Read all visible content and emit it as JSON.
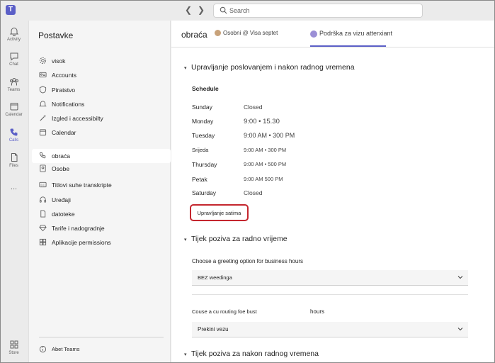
{
  "search": {
    "placeholder": "Search"
  },
  "rail": {
    "items": [
      {
        "label": "Activity",
        "icon": "bell-icon"
      },
      {
        "label": "Chat",
        "icon": "chat-icon"
      },
      {
        "label": "Teams",
        "icon": "teams-icon"
      },
      {
        "label": "Calendar",
        "icon": "calendar-icon"
      },
      {
        "label": "Calls",
        "icon": "phone-icon",
        "active": true
      },
      {
        "label": "Files",
        "icon": "file-icon"
      },
      {
        "label": "...",
        "icon": "more-icon"
      },
      {
        "label": "Store",
        "icon": "store-icon"
      }
    ]
  },
  "settings": {
    "title": "Postavke",
    "items": [
      {
        "label": "visok",
        "icon": "gear-icon"
      },
      {
        "label": "Accounts",
        "icon": "id-card-icon"
      },
      {
        "label": "Piratstvo",
        "icon": "shield-icon"
      },
      {
        "label": "Notifications",
        "icon": "bell-icon"
      },
      {
        "label": "Izgled i accessibilty",
        "icon": "wand-icon"
      },
      {
        "label": "Calendar",
        "icon": "calendar-icon"
      },
      {
        "label": "obraća",
        "icon": "phone-icon",
        "selected": true
      },
      {
        "label": "Osobe",
        "icon": "contact-card-icon"
      },
      {
        "label": "Titlovi suhe transkripte",
        "icon": "cc-icon"
      },
      {
        "label": "Uređaji",
        "icon": "headset-icon"
      },
      {
        "label": "datoteke",
        "icon": "file-icon"
      },
      {
        "label": "Tarife i nadogradnje",
        "icon": "diamond-icon"
      },
      {
        "label": "Aplikacije permissions",
        "icon": "apps-icon"
      }
    ],
    "footer": {
      "label": "Abet Teams",
      "icon": "info-icon"
    }
  },
  "main": {
    "title": "obraća",
    "tabs": [
      {
        "label": "Osobni @ Visa septet"
      },
      {
        "label": "Podrška za vizu atterxiant"
      }
    ],
    "business_hours": {
      "heading": "Upravljanje poslovanjem i nakon radnog vremena",
      "schedule_title": "Schedule",
      "days": [
        {
          "day": "Sunday",
          "time": "Closed"
        },
        {
          "day": "Monday",
          "time": "9:00 • 15.30"
        },
        {
          "day": "Tuesday",
          "time": "9:00 AM • 300 PM"
        },
        {
          "day": "Srijeda",
          "time": "9:00 AM • 300 PM"
        },
        {
          "day": "Thursday",
          "time": "9:00 AM • 500 PM"
        },
        {
          "day": "Petak",
          "time": "9:00 AM 500 PM"
        },
        {
          "day": "Saturday",
          "time": "Closed"
        }
      ],
      "manage_button": "Upravljanje satima"
    },
    "call_flow_business": {
      "heading": "Tijek poziva za radno vrijeme",
      "greeting_label": "Choose a greeting option for business hours",
      "greeting_value": "BEZ weedinga",
      "routing_label": "Couse a cu routing foe bust",
      "routing_label_suffix": "hours",
      "routing_value": "Prekini vezu"
    },
    "call_flow_after": {
      "heading": "Tijek poziva za nakon radnog vremena"
    }
  },
  "colors": {
    "accent": "#5b5fc7",
    "highlight_border": "#c4262e"
  }
}
